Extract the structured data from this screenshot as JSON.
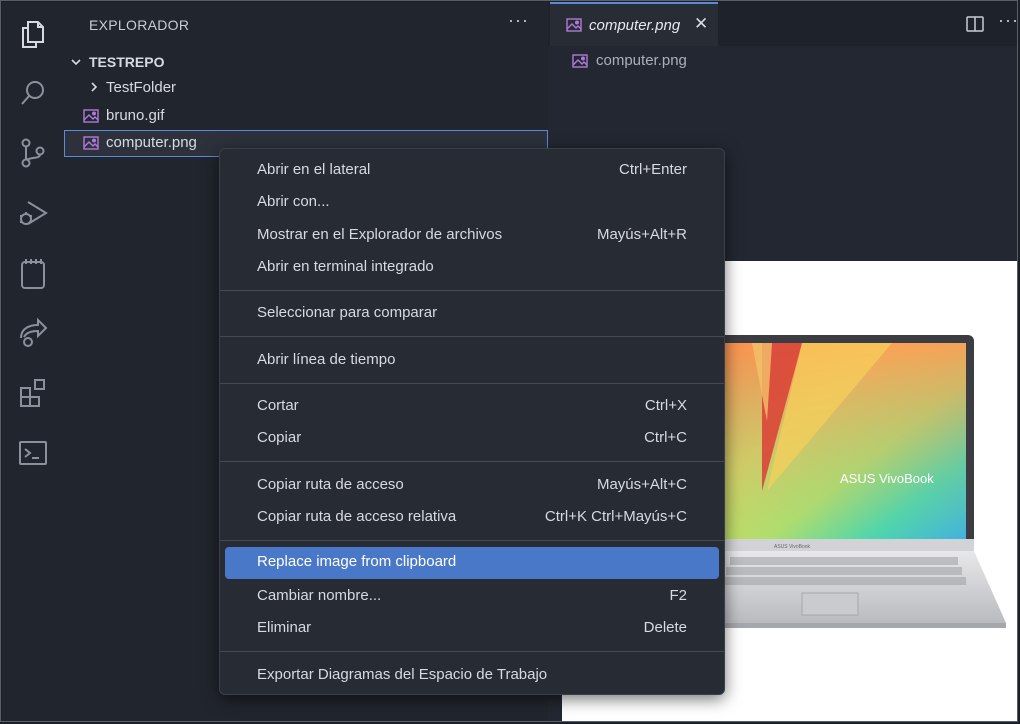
{
  "sidebar": {
    "title": "EXPLORADOR",
    "more": "···",
    "root": "TESTREPO",
    "items": [
      {
        "label": "TestFolder",
        "type": "folder"
      },
      {
        "label": "bruno.gif",
        "type": "image"
      },
      {
        "label": "computer.png",
        "type": "image",
        "selected": true
      }
    ]
  },
  "editor": {
    "tab_label": "computer.png",
    "tab_close": "✕",
    "more": "···",
    "breadcrumb": "computer.png"
  },
  "image": {
    "brand_text": "ASUS VivoBook",
    "hinge_text": "ASUS VivoBook"
  },
  "menu": {
    "open_side": {
      "label": "Abrir en el lateral",
      "shortcut": "Ctrl+Enter"
    },
    "open_with": {
      "label": "Abrir con..."
    },
    "reveal": {
      "label": "Mostrar en el Explorador de archivos",
      "shortcut": "Mayús+Alt+R"
    },
    "open_terminal": {
      "label": "Abrir en terminal integrado"
    },
    "select_compare": {
      "label": "Seleccionar para comparar"
    },
    "timeline": {
      "label": "Abrir línea de tiempo"
    },
    "cut": {
      "label": "Cortar",
      "shortcut": "Ctrl+X"
    },
    "copy": {
      "label": "Copiar",
      "shortcut": "Ctrl+C"
    },
    "copy_path": {
      "label": "Copiar ruta de acceso",
      "shortcut": "Mayús+Alt+C"
    },
    "copy_rel_path": {
      "label": "Copiar ruta de acceso relativa",
      "shortcut": "Ctrl+K Ctrl+Mayús+C"
    },
    "replace_image": {
      "label": "Replace image from clipboard"
    },
    "rename": {
      "label": "Cambiar nombre...",
      "shortcut": "F2"
    },
    "delete": {
      "label": "Eliminar",
      "shortcut": "Delete"
    },
    "export": {
      "label": "Exportar Diagramas del Espacio de Trabajo"
    }
  },
  "colors": {
    "accent": "#4a78c9",
    "background": "#21252d",
    "file_icon": "#b07ad8"
  }
}
